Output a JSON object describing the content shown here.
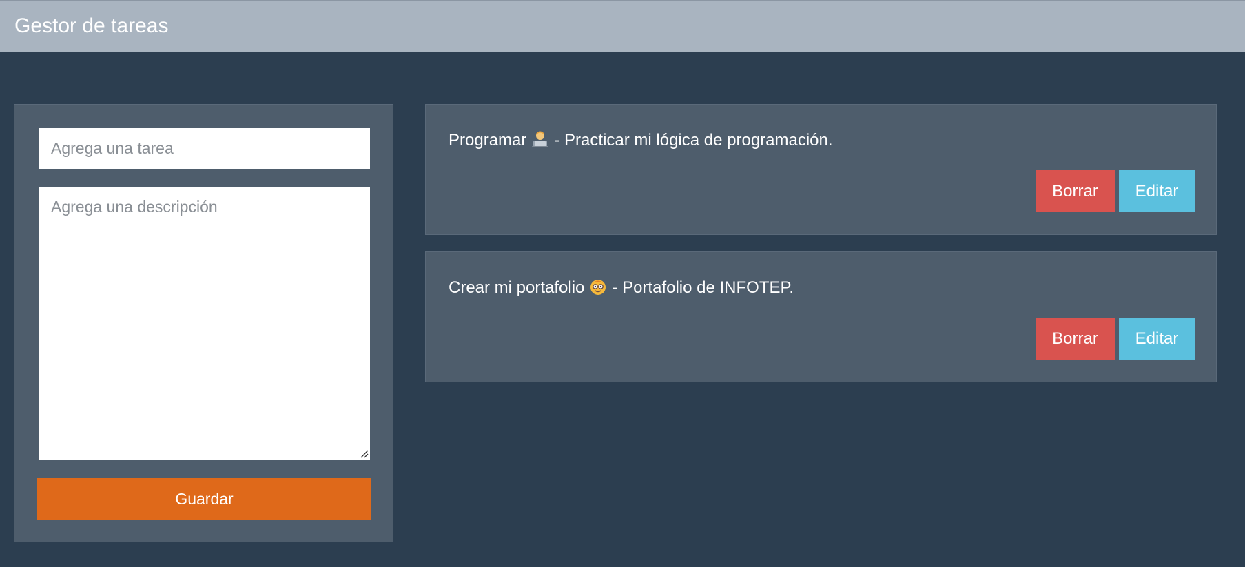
{
  "app": {
    "title": "Gestor de tareas"
  },
  "form": {
    "task_placeholder": "Agrega una tarea",
    "task_value": "",
    "description_placeholder": "Agrega una descripción",
    "description_value": "",
    "save_label": "Guardar"
  },
  "tasks": [
    {
      "title": "Programar",
      "icon": "technologist-emoji",
      "separator": "-",
      "description": "Practicar mi lógica de programación.",
      "delete_label": "Borrar",
      "edit_label": "Editar"
    },
    {
      "title": "Crear mi portafolio",
      "icon": "nerd-face-emoji",
      "separator": "-",
      "description": "Portafolio de INFOTEP.",
      "delete_label": "Borrar",
      "edit_label": "Editar"
    }
  ],
  "colors": {
    "background": "#2c3e50",
    "navbar": "#a9b4c0",
    "card": "#4e5d6c",
    "primary": "#df691a",
    "danger": "#d9534f",
    "info": "#5bc0de"
  }
}
